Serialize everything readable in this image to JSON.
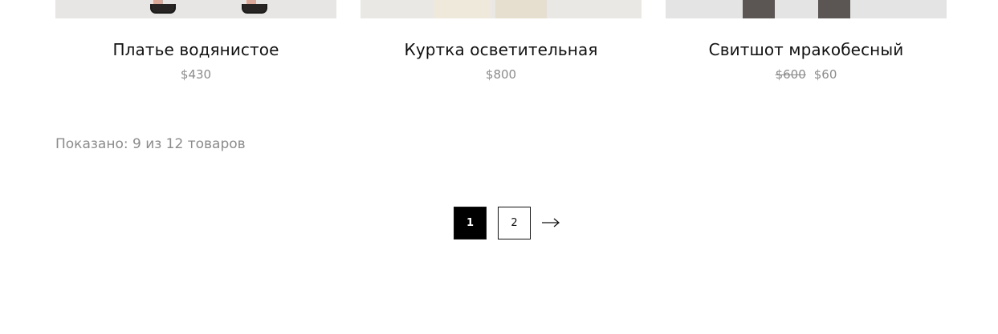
{
  "products": [
    {
      "title": "Платье водянистое",
      "price": "$430"
    },
    {
      "title": "Куртка осветительная",
      "price": "$800"
    },
    {
      "title": "Свитшот мракобесный",
      "old_price": "$600",
      "price": "$60"
    }
  ],
  "shown": "Показано: 9 из 12 товаров",
  "pagination": {
    "pages": [
      "1",
      "2"
    ],
    "current": "1",
    "next_icon": "arrow-right-icon"
  },
  "colors": {
    "active_page_bg": "#000000",
    "price_text": "#8b8b8b"
  }
}
